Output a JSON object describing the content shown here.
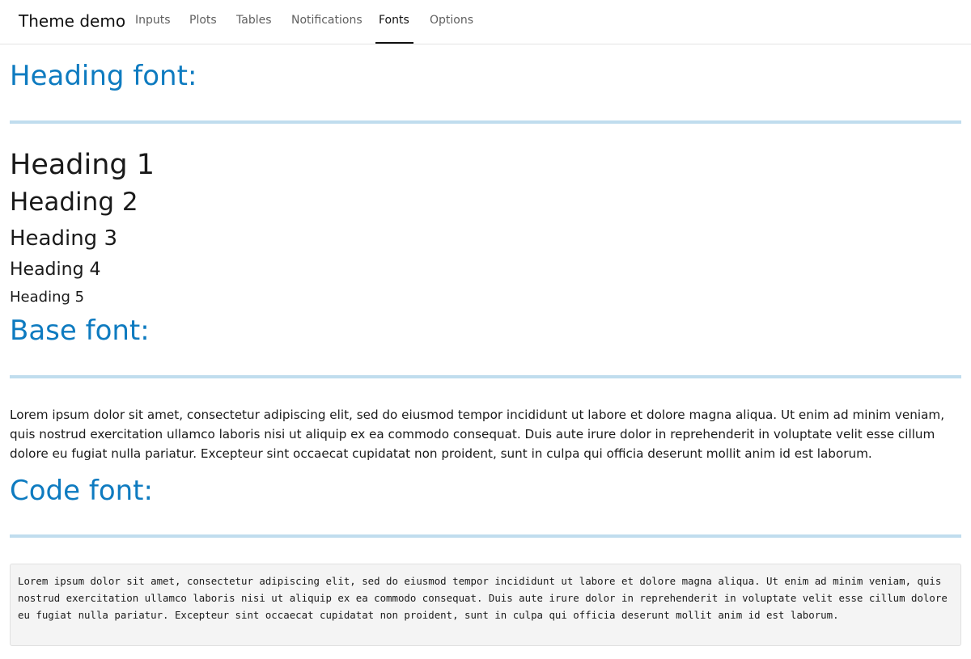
{
  "navbar": {
    "brand": "Theme demo",
    "tabs": [
      {
        "label": "Inputs"
      },
      {
        "label": "Plots"
      },
      {
        "label": "Tables"
      },
      {
        "label": "Notifications"
      },
      {
        "label": "Fonts",
        "active": true
      },
      {
        "label": "Options"
      }
    ]
  },
  "sections": {
    "heading": {
      "title": "Heading font:",
      "samples": [
        "Heading 1",
        "Heading 2",
        "Heading 3",
        "Heading 4",
        "Heading 5"
      ]
    },
    "base": {
      "title": "Base font:",
      "text": "Lorem ipsum dolor sit amet, consectetur adipiscing elit, sed do eiusmod tempor incididunt ut labore et dolore magna aliqua. Ut enim ad minim veniam, quis nostrud exercitation ullamco laboris nisi ut aliquip ex ea commodo consequat. Duis aute irure dolor in reprehenderit in voluptate velit esse cillum dolore eu fugiat nulla pariatur. Excepteur sint occaecat cupidatat non proident, sunt in culpa qui officia deserunt mollit anim id est laborum."
    },
    "code": {
      "title": "Code font:",
      "text": "Lorem ipsum dolor sit amet, consectetur adipiscing elit, sed do eiusmod tempor incididunt ut labore et dolore magna aliqua. Ut enim ad minim veniam, quis nostrud exercitation ullamco laboris nisi ut aliquip ex ea commodo consequat. Duis aute irure dolor in reprehenderit in voluptate velit esse cillum dolore eu fugiat nulla pariatur. Excepteur sint occaecat cupidatat non proident, sunt in culpa qui officia deserunt mollit anim id est laborum."
    }
  },
  "colors": {
    "accent": "#0e7bc0",
    "rule": "#c0ddee",
    "code_background": "#f4f4f4"
  }
}
